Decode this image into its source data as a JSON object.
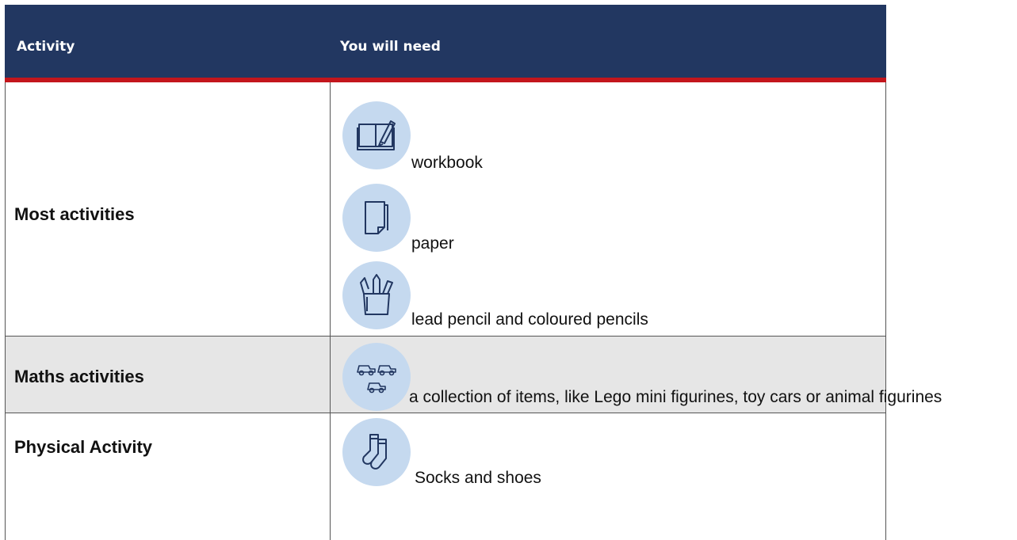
{
  "header": {
    "col_activity": "Activity",
    "col_need": "You will need"
  },
  "rows": [
    {
      "label": "Most activities",
      "items": [
        {
          "icon": "workbook-icon",
          "text": "workbook"
        },
        {
          "icon": "paper-icon",
          "text": "paper"
        },
        {
          "icon": "pencil-cup-icon",
          "text": "lead pencil and coloured pencils"
        }
      ]
    },
    {
      "label": "Maths activities",
      "items": [
        {
          "icon": "toy-cars-icon",
          "text": "a collection of items, like Lego mini figurines, toy cars or animal figurines"
        }
      ]
    },
    {
      "label": "Physical Activity",
      "items": [
        {
          "icon": "socks-icon",
          "text": "Socks and shoes"
        }
      ]
    }
  ],
  "colors": {
    "header_bg": "#223761",
    "header_rule": "#c3161c",
    "icon_circle": "#c5d9ef",
    "alt_row": "#e6e6e6"
  }
}
